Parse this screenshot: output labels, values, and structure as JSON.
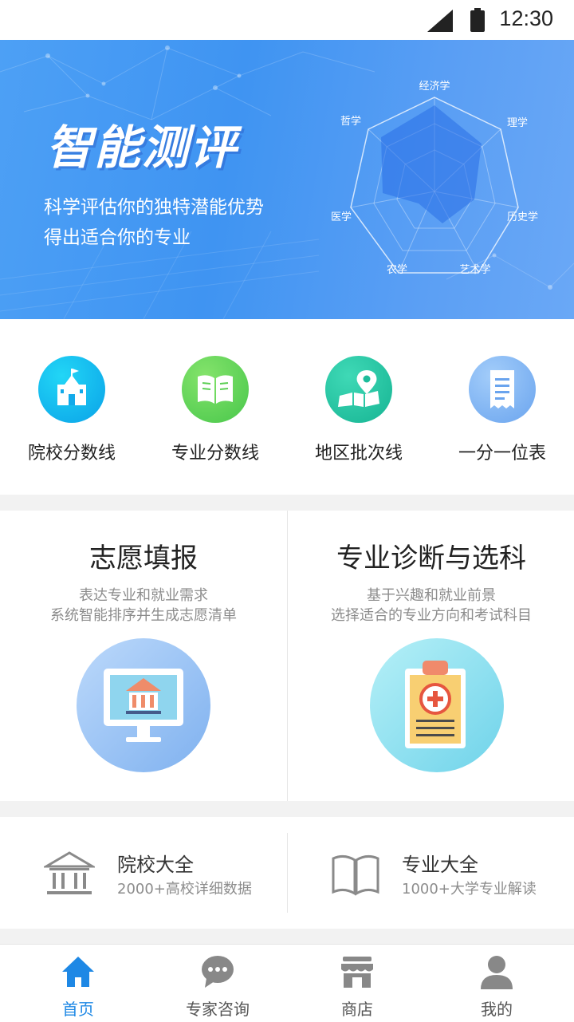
{
  "status_bar": {
    "time": "12:30"
  },
  "banner": {
    "title": "智能测评",
    "subtitle_line1": "科学评估你的独特潜能优势",
    "subtitle_line2": "得出适合你的专业",
    "radar_labels": [
      "经济学",
      "理学",
      "历史学",
      "艺术学",
      "农学",
      "医学",
      "哲学"
    ]
  },
  "quick_links": [
    {
      "label": "院校分数线",
      "icon": "school-building-icon",
      "color": "#14b7ee"
    },
    {
      "label": "专业分数线",
      "icon": "open-book-icon",
      "color": "#5cd35a"
    },
    {
      "label": "地区批次线",
      "icon": "map-pin-icon",
      "color": "#27c6a4"
    },
    {
      "label": "一分一位表",
      "icon": "document-list-icon",
      "color": "#7cb2f3"
    }
  ],
  "feature_cards": [
    {
      "title": "志愿填报",
      "desc_line1": "表达专业和就业需求",
      "desc_line2": "系统智能排序并生成志愿清单",
      "icon": "monitor-university-icon"
    },
    {
      "title": "专业诊断与选科",
      "desc_line1": "基于兴趣和就业前景",
      "desc_line2": "选择适合的专业方向和考试科目",
      "icon": "clipboard-medical-icon"
    }
  ],
  "directories": [
    {
      "title": "院校大全",
      "desc": "2000+高校详细数据",
      "icon": "institution-icon"
    },
    {
      "title": "专业大全",
      "desc": "1000+大学专业解读",
      "icon": "book-icon"
    }
  ],
  "tab_bar": {
    "active": 0,
    "active_color": "#1e88e5",
    "items": [
      {
        "label": "首页",
        "icon": "home-icon"
      },
      {
        "label": "专家咨询",
        "icon": "chat-bubble-icon"
      },
      {
        "label": "商店",
        "icon": "store-icon"
      },
      {
        "label": "我的",
        "icon": "person-icon"
      }
    ]
  }
}
